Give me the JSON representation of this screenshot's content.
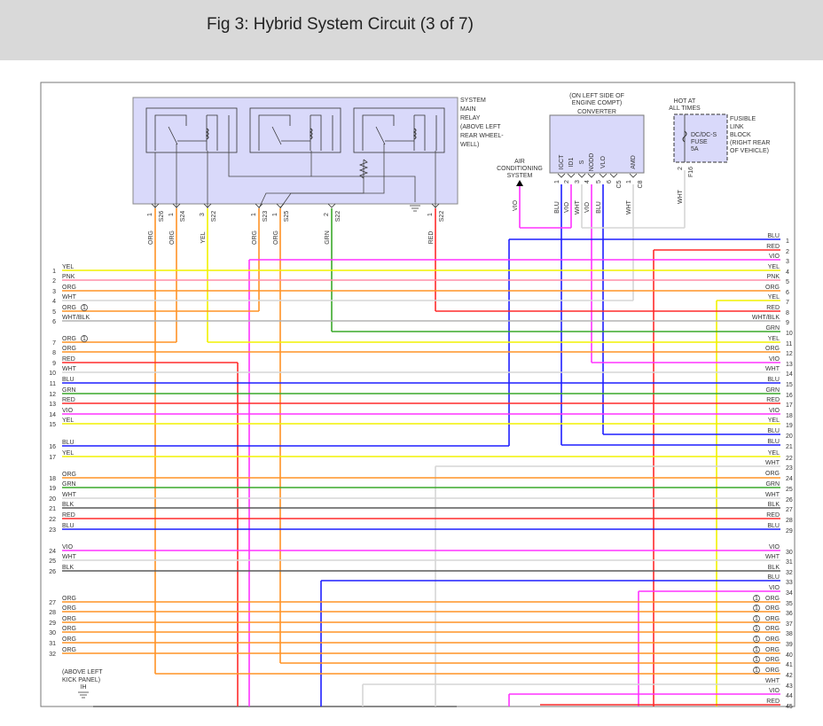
{
  "title": "Fig 3: Hybrid System Circuit (3 of 7)",
  "colors": {
    "ORG": "#ff9326",
    "YEL": "#f2f200",
    "PNK": "#ff8fa8",
    "WHT": "#d6d6d6",
    "WHT/BLK": "#b4b4b4",
    "RED": "#ff2b2b",
    "BLU": "#1f1fff",
    "GRN": "#3aa82a",
    "VIO": "#ff33ff",
    "BLK": "#5a5a5a",
    "relay_fill": "#d9d9fa"
  },
  "relay": {
    "label": [
      "SYSTEM",
      "MAIN",
      "RELAY",
      "(ABOVE LEFT",
      "REAR WHEEL-",
      "WELL)"
    ],
    "pins": [
      {
        "pin": "1",
        "conn": "S26",
        "wire": "ORG"
      },
      {
        "pin": "1",
        "conn": "S24",
        "wire": "ORG"
      },
      {
        "pin": "3",
        "conn": "S22",
        "wire": "YEL"
      },
      {
        "pin": "1",
        "conn": "S23",
        "wire": "ORG"
      },
      {
        "pin": "1",
        "conn": "S25",
        "wire": "ORG"
      },
      {
        "pin": "2",
        "conn": "S22",
        "wire": "GRN"
      },
      {
        "pin": "1",
        "conn": "S22",
        "wire": "RED"
      }
    ]
  },
  "converter": {
    "location": [
      "(ON LEFT SIDE OF",
      "ENGINE COMPT)"
    ],
    "name": "CONVERTER",
    "terminals": [
      "IGCT",
      "ID1",
      "S",
      "NODD",
      "VLO",
      "AMD"
    ],
    "pins": [
      {
        "pin": "1",
        "wire": "BLU"
      },
      {
        "pin": "2",
        "wire": "VIO"
      },
      {
        "pin": "3",
        "wire": "WHT"
      },
      {
        "pin": "4",
        "wire": "VIO"
      },
      {
        "pin": "5",
        "wire": "BLU"
      },
      {
        "pin": "6",
        "wire": ""
      },
      {
        "pin": "1",
        "wire": "WHT"
      }
    ],
    "conn_a": "C5",
    "conn_b": "C8"
  },
  "ac_system": [
    "AIR",
    "CONDITIONING",
    "SYSTEM"
  ],
  "ac_wire": "VIO",
  "fuse": {
    "hot": [
      "HOT AT",
      "ALL TIMES"
    ],
    "name": [
      "DC/DC-S",
      "FUSE",
      "5A"
    ],
    "block": [
      "FUSIBLE",
      "LINK",
      "BLOCK",
      "(RIGHT REAR",
      "OF VEHICLE)"
    ],
    "pin": "2",
    "conn": "F16",
    "wire": "WHT"
  },
  "ground": {
    "label": [
      "(ABOVE LEFT",
      "KICK PANEL)"
    ],
    "id": "IH"
  },
  "left_wires": [
    {
      "n": "1",
      "c": "YEL"
    },
    {
      "n": "2",
      "c": "PNK"
    },
    {
      "n": "3",
      "c": "ORG"
    },
    {
      "n": "4",
      "c": "WHT"
    },
    {
      "n": "5",
      "c": "ORG",
      "note": "1"
    },
    {
      "n": "6",
      "c": "WHT/BLK"
    },
    {
      "n": "7",
      "c": "ORG",
      "note": "1"
    },
    {
      "n": "8",
      "c": "ORG"
    },
    {
      "n": "9",
      "c": "RED"
    },
    {
      "n": "10",
      "c": "WHT"
    },
    {
      "n": "11",
      "c": "BLU"
    },
    {
      "n": "12",
      "c": "GRN"
    },
    {
      "n": "13",
      "c": "RED"
    },
    {
      "n": "14",
      "c": "VIO"
    },
    {
      "n": "15",
      "c": "YEL"
    },
    {
      "n": "16",
      "c": "BLU"
    },
    {
      "n": "17",
      "c": "YEL"
    },
    {
      "n": "18",
      "c": "ORG"
    },
    {
      "n": "19",
      "c": "GRN"
    },
    {
      "n": "20",
      "c": "WHT"
    },
    {
      "n": "21",
      "c": "BLK"
    },
    {
      "n": "22",
      "c": "RED"
    },
    {
      "n": "23",
      "c": "BLU"
    },
    {
      "n": "24",
      "c": "VIO"
    },
    {
      "n": "25",
      "c": "WHT"
    },
    {
      "n": "26",
      "c": "BLK"
    },
    {
      "n": "27",
      "c": "ORG"
    },
    {
      "n": "28",
      "c": "ORG"
    },
    {
      "n": "29",
      "c": "ORG"
    },
    {
      "n": "30",
      "c": "ORG"
    },
    {
      "n": "31",
      "c": "ORG"
    },
    {
      "n": "32",
      "c": "ORG"
    }
  ],
  "right_wires": [
    {
      "n": "1",
      "c": "BLU"
    },
    {
      "n": "2",
      "c": "RED"
    },
    {
      "n": "3",
      "c": "VIO"
    },
    {
      "n": "4",
      "c": "YEL"
    },
    {
      "n": "5",
      "c": "PNK"
    },
    {
      "n": "6",
      "c": "ORG"
    },
    {
      "n": "7",
      "c": "YEL"
    },
    {
      "n": "8",
      "c": "RED"
    },
    {
      "n": "9",
      "c": "WHT/BLK"
    },
    {
      "n": "10",
      "c": "GRN"
    },
    {
      "n": "11",
      "c": "YEL"
    },
    {
      "n": "12",
      "c": "ORG"
    },
    {
      "n": "13",
      "c": "VIO"
    },
    {
      "n": "14",
      "c": "WHT"
    },
    {
      "n": "15",
      "c": "BLU"
    },
    {
      "n": "16",
      "c": "GRN"
    },
    {
      "n": "17",
      "c": "RED"
    },
    {
      "n": "18",
      "c": "VIO"
    },
    {
      "n": "19",
      "c": "YEL"
    },
    {
      "n": "20",
      "c": "BLU"
    },
    {
      "n": "21",
      "c": "BLU"
    },
    {
      "n": "22",
      "c": "YEL"
    },
    {
      "n": "23",
      "c": "WHT"
    },
    {
      "n": "24",
      "c": "ORG"
    },
    {
      "n": "25",
      "c": "GRN"
    },
    {
      "n": "26",
      "c": "WHT"
    },
    {
      "n": "27",
      "c": "BLK"
    },
    {
      "n": "28",
      "c": "RED"
    },
    {
      "n": "29",
      "c": "BLU"
    },
    {
      "n": "30",
      "c": "VIO"
    },
    {
      "n": "31",
      "c": "WHT"
    },
    {
      "n": "32",
      "c": "BLK"
    },
    {
      "n": "33",
      "c": "BLU"
    },
    {
      "n": "34",
      "c": "VIO"
    },
    {
      "n": "35",
      "c": "ORG",
      "note": "1"
    },
    {
      "n": "36",
      "c": "ORG",
      "note": "1"
    },
    {
      "n": "37",
      "c": "ORG",
      "note": "1"
    },
    {
      "n": "38",
      "c": "ORG",
      "note": "1"
    },
    {
      "n": "39",
      "c": "ORG",
      "note": "1"
    },
    {
      "n": "40",
      "c": "ORG",
      "note": "1"
    },
    {
      "n": "41",
      "c": "ORG",
      "note": "1"
    },
    {
      "n": "42",
      "c": "ORG",
      "note": "1"
    },
    {
      "n": "43",
      "c": "WHT"
    },
    {
      "n": "44",
      "c": "VIO"
    },
    {
      "n": "45",
      "c": "RED"
    }
  ]
}
